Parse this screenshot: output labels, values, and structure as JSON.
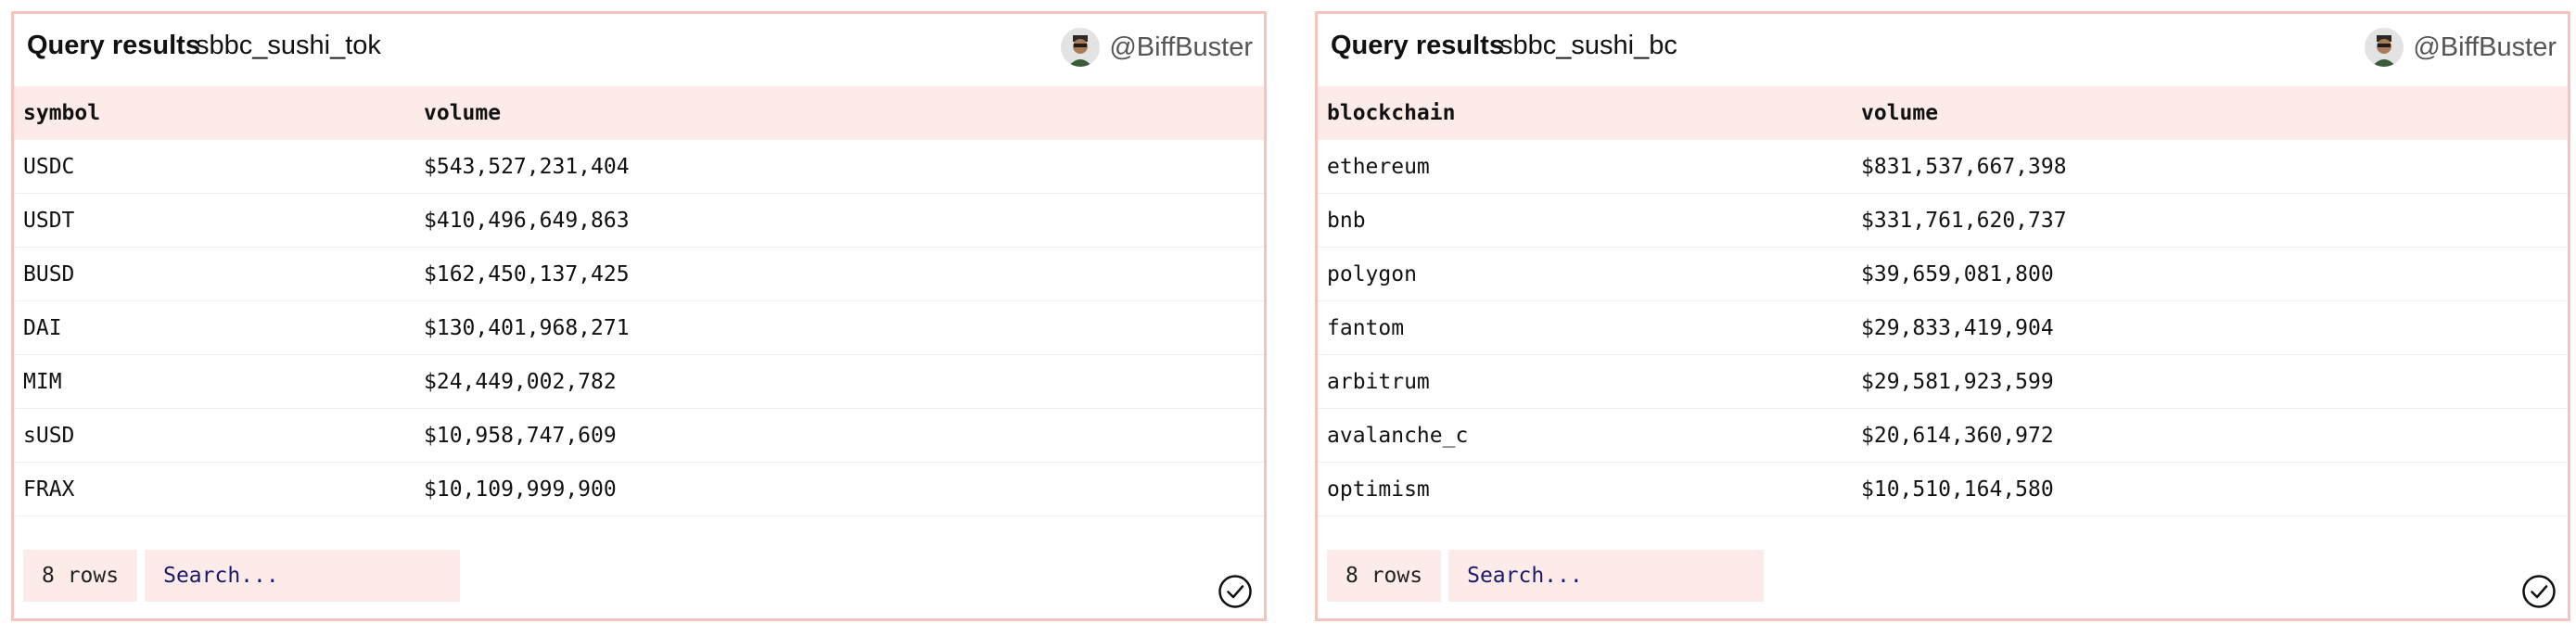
{
  "panels": [
    {
      "title": "Query results",
      "query_name": "sbbc_sushi_tok",
      "author": "@BiffBuster",
      "columns": [
        "symbol",
        "volume"
      ],
      "rows": [
        [
          "USDC",
          "$543,527,231,404"
        ],
        [
          "USDT",
          "$410,496,649,863"
        ],
        [
          "BUSD",
          "$162,450,137,425"
        ],
        [
          "DAI",
          "$130,401,968,271"
        ],
        [
          "MIM",
          "$24,449,002,782"
        ],
        [
          "sUSD",
          "$10,958,747,609"
        ],
        [
          "FRAX",
          "$10,109,999,900"
        ]
      ],
      "row_count": "8 rows",
      "search_placeholder": "Search..."
    },
    {
      "title": "Query results",
      "query_name": "sbbc_sushi_bc",
      "author": "@BiffBuster",
      "columns": [
        "blockchain",
        "volume"
      ],
      "rows": [
        [
          "ethereum",
          "$831,537,667,398"
        ],
        [
          "bnb",
          "$331,761,620,737"
        ],
        [
          "polygon",
          "$39,659,081,800"
        ],
        [
          "fantom",
          "$29,833,419,904"
        ],
        [
          "arbitrum",
          "$29,581,923,599"
        ],
        [
          "avalanche_c",
          "$20,614,360,972"
        ],
        [
          "optimism",
          "$10,510,164,580"
        ]
      ],
      "row_count": "8 rows",
      "search_placeholder": "Search..."
    }
  ],
  "icons": {
    "avatar": "user-avatar-icon",
    "status": "check-circle-icon"
  },
  "colors": {
    "accent_border": "#f6c4bd",
    "header_fill": "#fcebe8",
    "search_text": "#1a1a6b"
  }
}
